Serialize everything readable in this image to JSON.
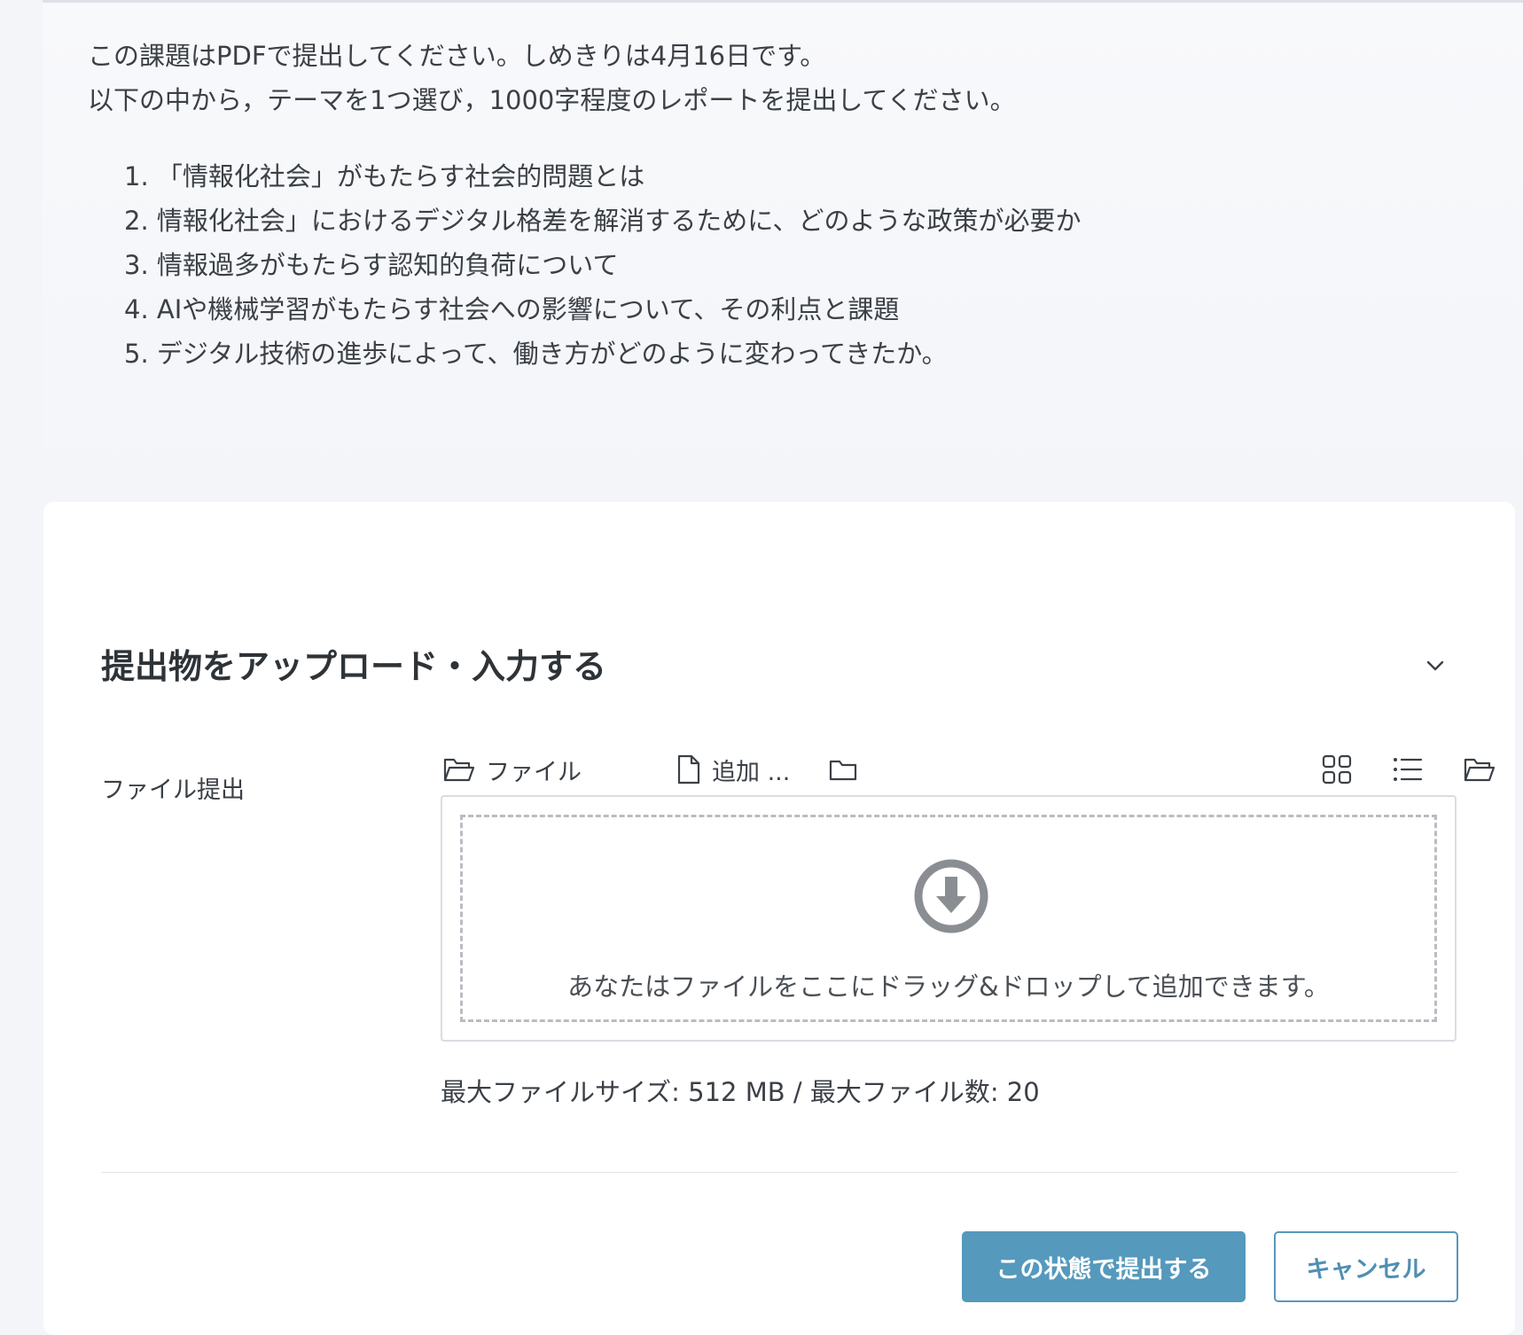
{
  "intro": {
    "line1": "この課題はPDFで提出してください。しめきりは4月16日です。",
    "line2": "以下の中から，テーマを1つ選び，1000字程度のレポートを提出してください。"
  },
  "topics": [
    "1. 「情報化社会」がもたらす社会的問題とは",
    "2. 情報化社会」におけるデジタル格差を解消するために、どのような政策が必要か",
    "3. 情報過多がもたらす認知的負荷について",
    "4. AIや機械学習がもたらす社会への影響について、その利点と課題",
    "5. デジタル技術の進歩によって、働き方がどのように変わってきたか。"
  ],
  "submission": {
    "section_title": "提出物をアップロード・入力する",
    "field_label": "ファイル提出",
    "toolbar": {
      "file_label": "ファイル",
      "add_label": "追加 ..."
    },
    "dropzone_text": "あなたはファイルをここにドラッグ&ドロップして追加できます。",
    "limits": "最大ファイルサイズ: 512 MB / 最大ファイル数: 20"
  },
  "actions": {
    "submit_label": "この状態で提出する",
    "cancel_label": "キャンセル"
  },
  "colors": {
    "primary": "#5599bd",
    "page_bg": "#f3f5f9",
    "text": "#3b4046"
  },
  "icons": {
    "toolbar": [
      "folder-open-icon",
      "file-icon",
      "folder-icon",
      "grid-view-icon",
      "list-view-icon",
      "folder-tree-icon"
    ],
    "dropzone": "download-circle-icon",
    "collapse": "chevron-down-icon"
  }
}
